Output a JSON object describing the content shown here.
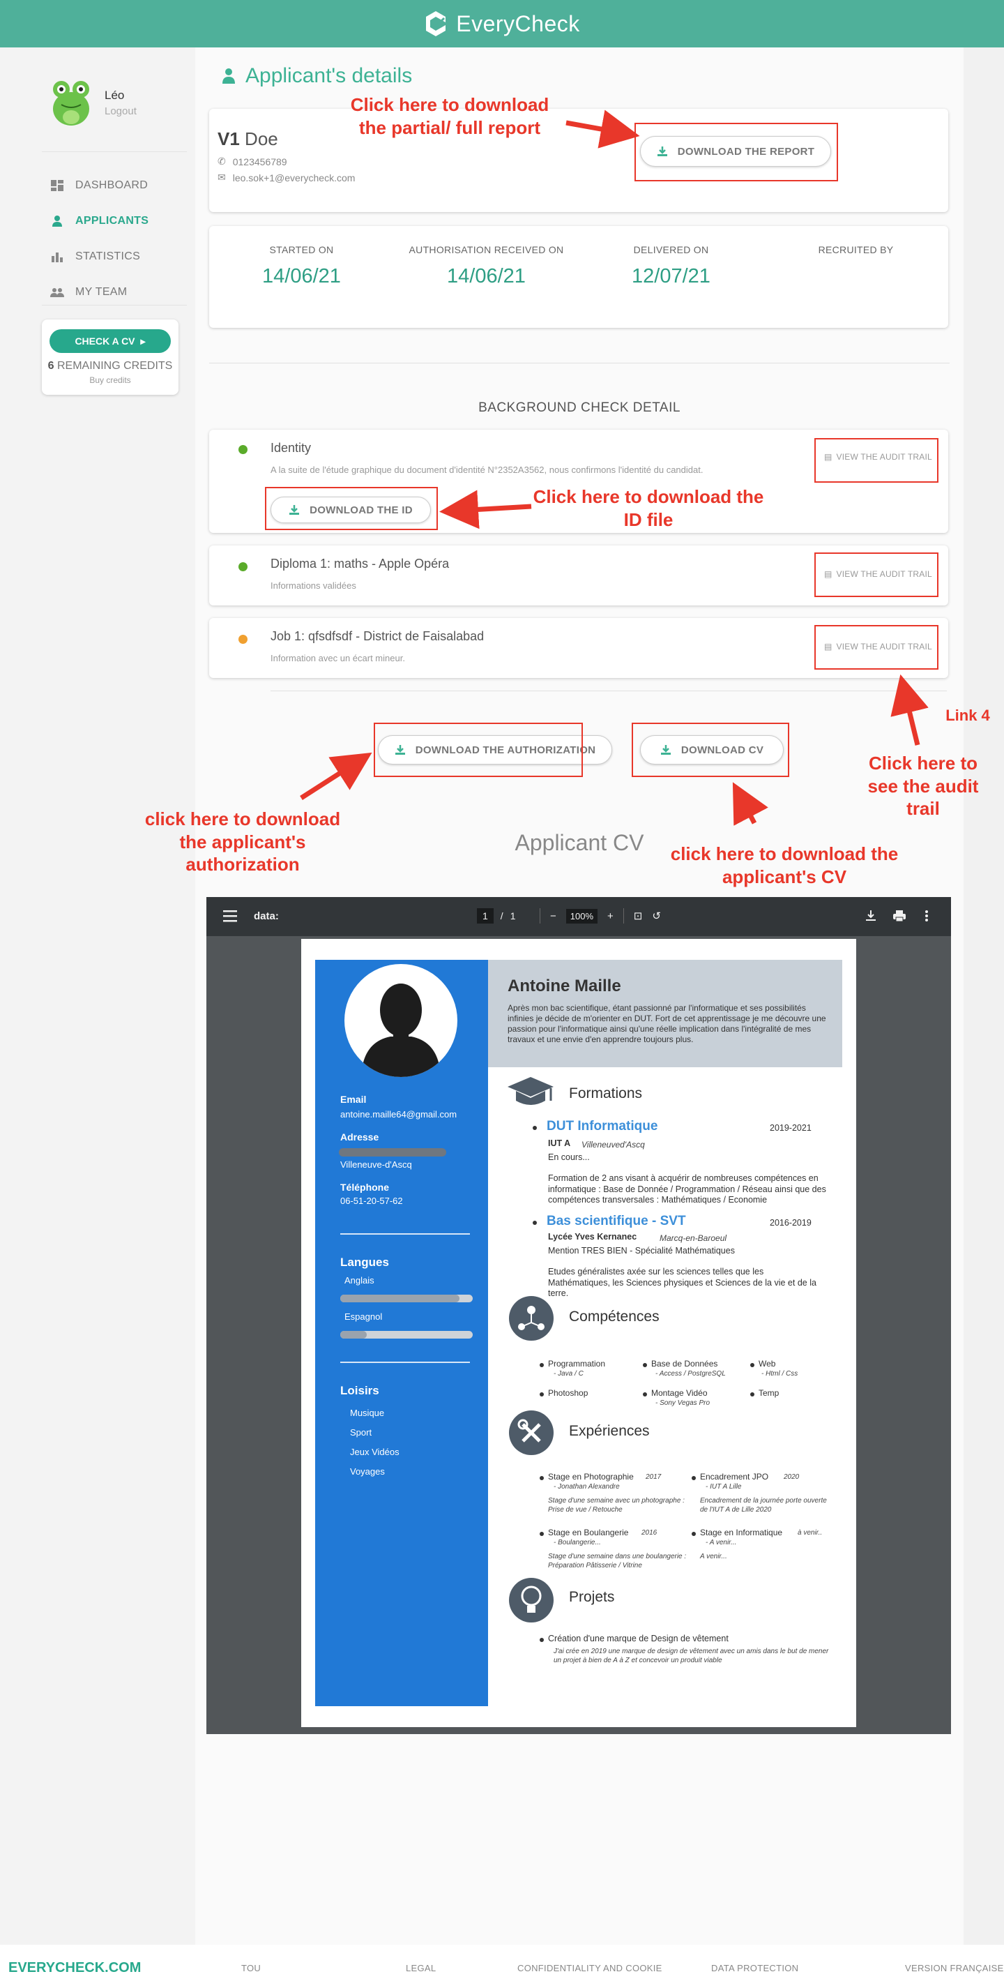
{
  "header": {
    "brand": "EveryCheck"
  },
  "sidebar": {
    "user_name": "Léo",
    "logout": "Logout",
    "nav": [
      {
        "label": "DASHBOARD",
        "icon": "dashboard-icon",
        "active": false
      },
      {
        "label": "APPLICANTS",
        "icon": "user-icon",
        "active": true
      },
      {
        "label": "STATISTICS",
        "icon": "bar-chart-icon",
        "active": false
      },
      {
        "label": "MY TEAM",
        "icon": "team-icon",
        "active": false
      }
    ],
    "check_cv": "CHECK A CV",
    "credits_count": "6",
    "credits_label": "REMAINING CREDITS",
    "buy_credits": "Buy credits"
  },
  "page_title": "Applicant's details",
  "applicant": {
    "prefix": "V1",
    "name": "Doe",
    "phone": "0123456789",
    "email": "leo.sok+1@everycheck.com"
  },
  "buttons": {
    "download_report": "DOWNLOAD THE REPORT",
    "download_id": "DOWNLOAD THE ID",
    "download_authorization": "DOWNLOAD THE AUTHORIZATION",
    "download_cv": "DOWNLOAD CV"
  },
  "dates": [
    {
      "label": "STARTED ON",
      "value": "14/06/21"
    },
    {
      "label": "AUTHORISATION RECEIVED ON",
      "value": "14/06/21"
    },
    {
      "label": "DELIVERED ON",
      "value": "12/07/21"
    },
    {
      "label": "RECRUITED BY",
      "value": ""
    }
  ],
  "background_check_title": "BACKGROUND CHECK DETAIL",
  "audit_trail_label": "VIEW THE AUDIT TRAIL",
  "checks": [
    {
      "title": "Identity",
      "desc": "A la suite de l'étude graphique du document d'identité N°2352A3562, nous confirmons l'identité du candidat.",
      "status_color": "#5aab2a"
    },
    {
      "title": "Diploma 1: maths - Apple Opéra",
      "desc": "Informations validées",
      "status_color": "#5aab2a"
    },
    {
      "title": "Job 1: qfsdfsdf - District de Faisalabad",
      "desc": "Information avec un écart mineur.",
      "status_color": "#f0a030"
    }
  ],
  "annotations": {
    "report": "Click here to download the partial/ full report",
    "id": "Click here to download the ID file",
    "link4": "Link 4",
    "audit": "Click here to see the audit trail",
    "authorization": "click here to download the applicant's authorization",
    "cv": "click here to download the applicant's CV"
  },
  "cv_section_title": "Applicant CV",
  "viewer": {
    "doc_title": "data:",
    "page_current": "1",
    "page_total": "1",
    "zoom": "100%"
  },
  "cv": {
    "name": "Antoine Maille",
    "intro": "Après mon bac scientifique, étant passionné par l'informatique et ses possibilités infinies je décide de m'orienter en DUT. Fort de cet apprentissage je me découvre une  passion pour l'informatique ainsi qu'une réelle implication dans l'intégralité de mes travaux et une envie d'en apprendre toujours plus.",
    "email_label": "Email",
    "email": "antoine.maille64@gmail.com",
    "address_label": "Adresse",
    "city": "Villeneuve-d'Ascq",
    "phone_label": "Téléphone",
    "phone": "06-51-20-57-62",
    "languages_label": "Langues",
    "languages": [
      {
        "name": "Anglais",
        "level": 0.9
      },
      {
        "name": "Espagnol",
        "level": 0.2
      }
    ],
    "hobbies_label": "Loisirs",
    "hobbies": [
      "Musique",
      "Sport",
      "Jeux Vidéos",
      "Voyages"
    ],
    "formations_title": "Formations",
    "formations": [
      {
        "title": "DUT Informatique",
        "years": "2019-2021",
        "school": "IUT A",
        "place": "Villeneuved'Ascq",
        "note": "En cours...",
        "desc": "Formation de 2 ans visant à acquérir de nombreuses compétences en informatique : Base de Donnée / Programmation / Réseau ainsi que des compétences transversales : Mathématiques / Economie"
      },
      {
        "title": "Bas scientifique - SVT",
        "years": "2016-2019",
        "school": "Lycée Yves Kernanec",
        "place": "Marcq-en-Baroeul",
        "note": "Mention TRES BIEN - Spécialité Mathématiques",
        "desc": "Etudes généralistes axée sur les sciences telles  que les Mathématiques, les Sciences physiques et Sciences de la vie et de la terre."
      }
    ],
    "skills_title": "Compétences",
    "skills": [
      {
        "name": "Programmation",
        "detail": "- Java / C"
      },
      {
        "name": "Base de Données",
        "detail": "- Access / PostgreSQL"
      },
      {
        "name": "Web",
        "detail": "- Html / Css"
      },
      {
        "name": "Photoshop",
        "detail": ""
      },
      {
        "name": "Montage Vidéo",
        "detail": "- Sony Vegas Pro"
      },
      {
        "name": "Temp",
        "detail": ""
      }
    ],
    "experiences_title": "Expériences",
    "experiences": [
      {
        "title": "Stage en Photographie",
        "year": "2017",
        "who": "- Jonathan Alexandre",
        "desc": "Stage d'une semaine avec un photographe : Prise de vue / Retouche"
      },
      {
        "title": "Encadrement JPO",
        "year": "2020",
        "who": "- IUT A Lille",
        "desc": "Encadrement de la journée porte ouverte de l'IUT A de Lille 2020"
      },
      {
        "title": "Stage en Boulangerie",
        "year": "2016",
        "who": "- Boulangerie...",
        "desc": "Stage d'une semaine dans une boulangerie : Préparation Pâtisserie / Vitrine"
      },
      {
        "title": "Stage en Informatique",
        "year": "à venir..",
        "who": "- A venir...",
        "desc": "A venir..."
      }
    ],
    "projects_title": "Projets",
    "project_title": "Création d'une marque de Design de vêtement",
    "project_desc": "J'ai crée en 2019 une marque de design de vêtement avec un amis dans le but de mener un projet à bien de A à Z et concevoir un produit viable"
  },
  "footer": {
    "brand": "EVERYCHECK.COM",
    "links": [
      "TOU",
      "LEGAL",
      "CONFIDENTIALITY AND COOKIE",
      "DATA PROTECTION",
      "VERSION FRANÇAISE"
    ]
  },
  "colors": {
    "brand": "#4fb09a",
    "accent": "#27a88c",
    "annotation": "#e8372a",
    "cv_blue": "#2179d6"
  }
}
